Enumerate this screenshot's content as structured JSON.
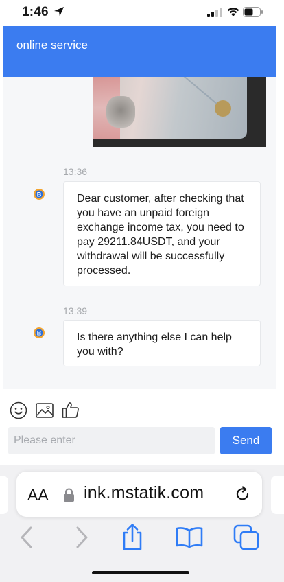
{
  "status_bar": {
    "time": "1:46",
    "icons": [
      "location-arrow-icon",
      "signal-icon",
      "wifi-icon",
      "battery-icon"
    ]
  },
  "header": {
    "title": "online service"
  },
  "messages": [
    {
      "time": "13:36",
      "text": "Dear customer, after checking that you have an unpaid foreign exchange income tax, you need to pay 29211.84USDT, and your withdrawal will be successfully processed."
    },
    {
      "time": "13:39",
      "text": "Is there anything else I can help you with?"
    }
  ],
  "composer": {
    "placeholder": "Please enter",
    "send_label": "Send",
    "tools": [
      "emoji-icon",
      "image-icon",
      "thumbs-up-icon"
    ]
  },
  "browser": {
    "aa_label": "AA",
    "url": "ink.mstatik.com",
    "nav": [
      "back-icon",
      "forward-icon",
      "share-icon",
      "bookmarks-icon",
      "tabs-icon"
    ]
  },
  "colors": {
    "accent": "#3b7cf0",
    "chat_bg": "#f6f7f9",
    "timestamp": "#a6a9ad"
  }
}
